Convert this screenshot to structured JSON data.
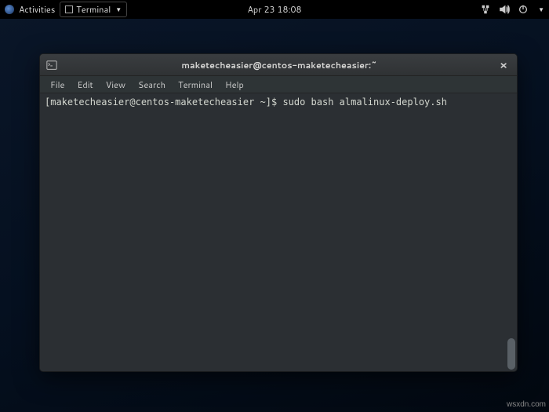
{
  "topbar": {
    "activities": "Activities",
    "app_name": "Terminal",
    "datetime": "Apr 23  18:08"
  },
  "window": {
    "title": "maketecheasier@centos-maketecheasier:~",
    "menu": {
      "file": "File",
      "edit": "Edit",
      "view": "View",
      "search": "Search",
      "terminal": "Terminal",
      "help": "Help"
    }
  },
  "terminal": {
    "prompt": "[maketecheasier@centos-maketecheasier ~]$ ",
    "command": "sudo bash almalinux-deploy.sh"
  },
  "watermark": "wsxdn.com"
}
